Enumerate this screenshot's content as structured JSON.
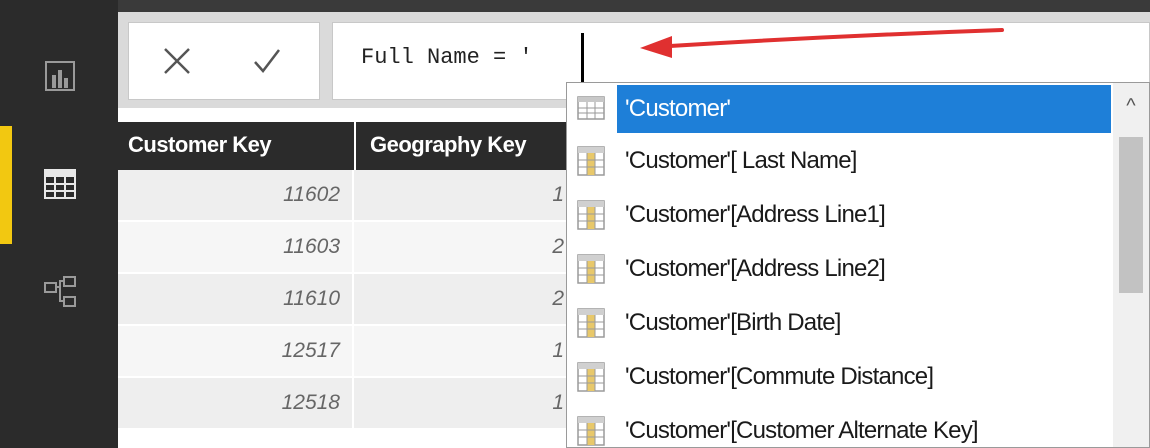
{
  "rail": {
    "items": [
      {
        "icon": "report-icon"
      },
      {
        "icon": "data-icon",
        "active": true
      },
      {
        "icon": "relationships-icon"
      }
    ],
    "accent_color": "#f2c811"
  },
  "formula_bar": {
    "cancel_icon": "close-icon",
    "commit_icon": "checkmark-icon",
    "text": "Full Name = '"
  },
  "table": {
    "columns": [
      "Customer Key",
      "Geography Key"
    ],
    "rows": [
      {
        "customer_key": "11602",
        "geography_key": "1"
      },
      {
        "customer_key": "11603",
        "geography_key": "2"
      },
      {
        "customer_key": "11610",
        "geography_key": "2"
      },
      {
        "customer_key": "12517",
        "geography_key": "1"
      },
      {
        "customer_key": "12518",
        "geography_key": "1"
      }
    ]
  },
  "autocomplete": {
    "items": [
      {
        "label": "'Customer'",
        "icon": "table-icon",
        "selected": true
      },
      {
        "label": "'Customer'[ Last Name]",
        "icon": "column-icon"
      },
      {
        "label": "'Customer'[Address Line1]",
        "icon": "column-icon"
      },
      {
        "label": "'Customer'[Address Line2]",
        "icon": "column-icon"
      },
      {
        "label": "'Customer'[Birth Date]",
        "icon": "column-icon"
      },
      {
        "label": "'Customer'[Commute Distance]",
        "icon": "column-icon"
      },
      {
        "label": "'Customer'[Customer Alternate Key]",
        "icon": "column-icon"
      }
    ],
    "selection_color": "#1e7fd8",
    "scroll_up_glyph": "^"
  },
  "annotation": {
    "arrow_color": "#e03030"
  }
}
